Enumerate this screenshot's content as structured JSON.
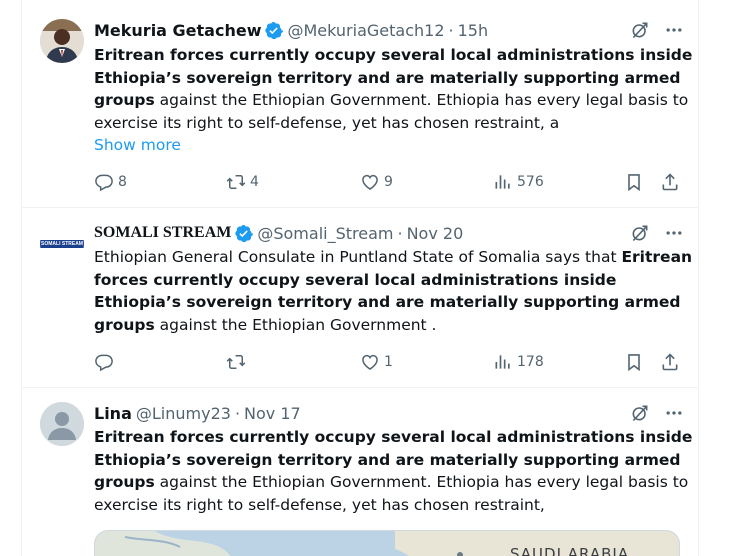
{
  "tweets": [
    {
      "name": "Mekuria Getachew",
      "handle": "@MekuriaGetach12",
      "time": "15h",
      "verified": true,
      "text_intro": "",
      "text_bold": "Eritrean forces currently occupy several local administrations inside Ethiopia’s sovereign territory and are materially supporting armed groups",
      "text_rest": " against the Ethiopian Government. Ethiopia has every legal basis to exercise its right to self-defense, yet has chosen restraint, a",
      "show_more": "Show more",
      "replies": "8",
      "reposts": "4",
      "likes": "9",
      "views": "576"
    },
    {
      "name": "SOMALI STREAM",
      "handle": "@Somali_Stream",
      "time": "Nov 20",
      "verified": true,
      "avatar_text": "SOMALI STREAM",
      "text_intro": "Ethiopian General Consulate in Puntland State of Somalia says that ",
      "text_bold": "Eritrean forces currently occupy several local administrations inside Ethiopia’s sovereign territory and are materially supporting armed groups",
      "text_rest": " against the Ethiopian Government .",
      "replies": "",
      "reposts": "",
      "likes": "1",
      "views": "178"
    },
    {
      "name": "Lina",
      "handle": "@Linumy23",
      "time": "Nov 17",
      "verified": false,
      "text_intro": "",
      "text_bold": "Eritrean forces currently occupy several local administrations inside Ethiopia’s sovereign territory and are materially supporting armed groups",
      "text_rest": " against the Ethiopian Government. Ethiopia has every legal basis to exercise its right to self-defense, yet has chosen restraint,",
      "media_label": "SAUDI ARABIA"
    }
  ],
  "icons": {
    "verified": "verified-badge-icon",
    "grok": "grok-icon",
    "more": "more-icon",
    "reply": "reply-icon",
    "repost": "repost-icon",
    "like": "like-icon",
    "views": "views-icon",
    "bookmark": "bookmark-icon",
    "share": "share-icon"
  },
  "colors": {
    "accent": "#1d9bf0",
    "secondary_text": "#536471",
    "border": "#eff3f4"
  }
}
